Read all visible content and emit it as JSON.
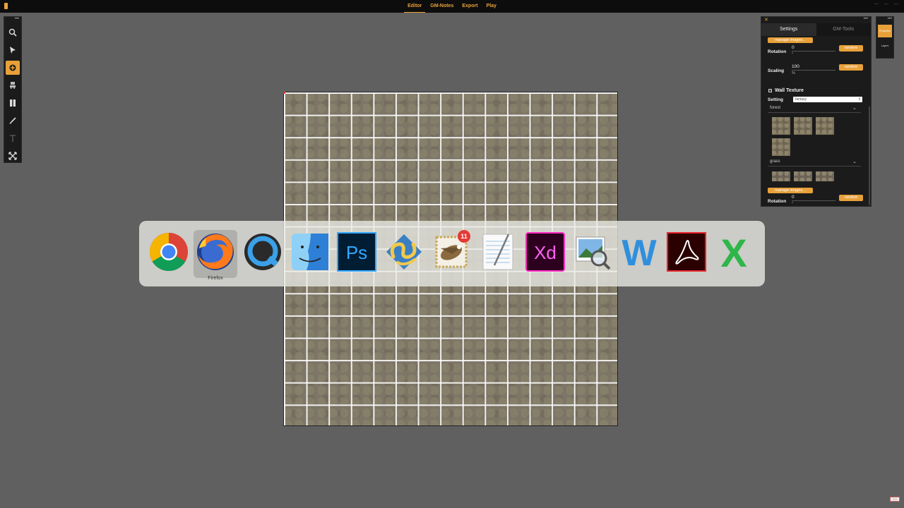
{
  "topbar": {
    "nav": [
      {
        "label": "Editor",
        "active": true
      },
      {
        "label": "GM-Notes",
        "active": false
      },
      {
        "label": "Export",
        "active": false
      },
      {
        "label": "Play",
        "active": false
      }
    ]
  },
  "toolbar": {
    "more": "•••",
    "tools": [
      {
        "icon": "zoom-icon",
        "active": false
      },
      {
        "icon": "pointer-icon",
        "active": false
      },
      {
        "icon": "stamp-icon",
        "active": true
      },
      {
        "icon": "asset-icon",
        "active": false
      },
      {
        "icon": "wall-icon",
        "active": false
      },
      {
        "icon": "brush-icon",
        "active": false
      },
      {
        "icon": "text-icon",
        "active": false
      },
      {
        "icon": "fullscreen-icon",
        "active": false
      }
    ]
  },
  "panel": {
    "close": "✕",
    "more": "•••",
    "tabs": [
      {
        "label": "Settings",
        "active": true
      },
      {
        "label": "GM-Tools",
        "active": false
      }
    ],
    "manage_images_1": "manage images...",
    "rotation_label": "Rotation",
    "rotation_value": "0",
    "rotation_unit": "°",
    "random_1": "random",
    "scaling_label": "Scaling",
    "scaling_value": "100",
    "scaling_unit": "%",
    "random_2": "random",
    "wall_texture_label": "Wall Texture",
    "setting_label": "Setting",
    "setting_value": "fantasy",
    "group_1": "forest",
    "group_2": "grass",
    "manage_images_2": "manage images...",
    "rotation_label_2": "Rotation",
    "rotation_value_2": "0",
    "rotation_unit_2": "°",
    "random_3": "random"
  },
  "mini_panel": {
    "more": "•••",
    "buttons": [
      {
        "label": "Properties",
        "active": true
      },
      {
        "label": "Layers",
        "active": false
      }
    ]
  },
  "dock": {
    "selected_label": "Firefox",
    "apps": [
      {
        "name": "Chrome",
        "icon": "chrome-icon"
      },
      {
        "name": "Firefox",
        "icon": "firefox-icon"
      },
      {
        "name": "QuickTime",
        "icon": "quicktime-icon"
      },
      {
        "name": "Finder",
        "icon": "finder-icon"
      },
      {
        "name": "Photoshop",
        "icon": "photoshop-icon",
        "text": "Ps"
      },
      {
        "name": "Fetch",
        "icon": "fetch-icon"
      },
      {
        "name": "Mail",
        "icon": "mail-icon",
        "badge": "11"
      },
      {
        "name": "TextEdit",
        "icon": "textedit-icon"
      },
      {
        "name": "Adobe XD",
        "icon": "xd-icon",
        "text": "Xd"
      },
      {
        "name": "Preview",
        "icon": "preview-icon"
      },
      {
        "name": "Word",
        "icon": "word-icon",
        "text": "W"
      },
      {
        "name": "Acrobat",
        "icon": "acrobat-icon"
      },
      {
        "name": "Excel",
        "icon": "excel-icon",
        "text": "X"
      }
    ]
  },
  "version": "0.9"
}
